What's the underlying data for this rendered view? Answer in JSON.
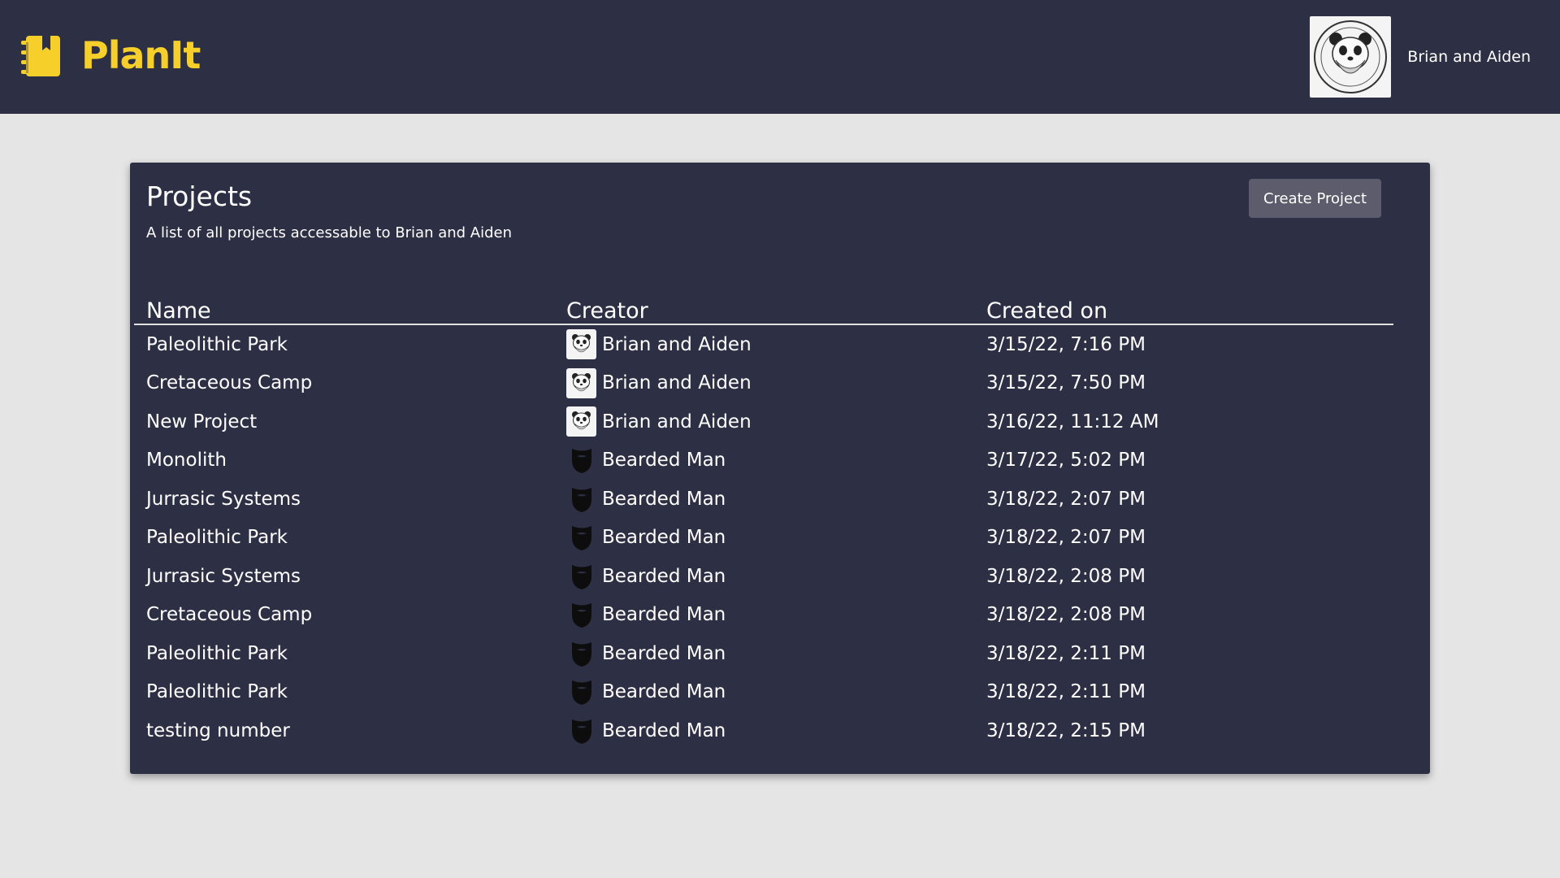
{
  "app": {
    "name": "PlanIt"
  },
  "brand": {
    "accent": "#f7cf2a",
    "surface": "#2d3044",
    "background": "#e5e5e5",
    "button": "#5d5c6c"
  },
  "user": {
    "name": "Brian and Aiden",
    "avatar_icon": "bearded-panda-logo-icon"
  },
  "projects_card": {
    "title": "Projects",
    "subtitle": "A list of all projects accessable to Brian and Aiden",
    "create_button_label": "Create Project",
    "columns": {
      "name": "Name",
      "creator": "Creator",
      "created_on": "Created on"
    },
    "rows": [
      {
        "name": "Paleolithic Park",
        "creator": "Brian and Aiden",
        "creator_icon": "panda-avatar-icon",
        "created_on": "3/15/22, 7:16 PM"
      },
      {
        "name": "Cretaceous Camp",
        "creator": "Brian and Aiden",
        "creator_icon": "panda-avatar-icon",
        "created_on": "3/15/22, 7:50 PM"
      },
      {
        "name": "New Project",
        "creator": "Brian and Aiden",
        "creator_icon": "panda-avatar-icon",
        "created_on": "3/16/22, 11:12 AM"
      },
      {
        "name": "Monolith",
        "creator": "Bearded Man",
        "creator_icon": "beard-avatar-icon",
        "created_on": "3/17/22, 5:02 PM"
      },
      {
        "name": "Jurrasic Systems",
        "creator": "Bearded Man",
        "creator_icon": "beard-avatar-icon",
        "created_on": "3/18/22, 2:07 PM"
      },
      {
        "name": "Paleolithic Park",
        "creator": "Bearded Man",
        "creator_icon": "beard-avatar-icon",
        "created_on": "3/18/22, 2:07 PM"
      },
      {
        "name": "Jurrasic Systems",
        "creator": "Bearded Man",
        "creator_icon": "beard-avatar-icon",
        "created_on": "3/18/22, 2:08 PM"
      },
      {
        "name": "Cretaceous Camp",
        "creator": "Bearded Man",
        "creator_icon": "beard-avatar-icon",
        "created_on": "3/18/22, 2:08 PM"
      },
      {
        "name": "Paleolithic Park",
        "creator": "Bearded Man",
        "creator_icon": "beard-avatar-icon",
        "created_on": "3/18/22, 2:11 PM"
      },
      {
        "name": "Paleolithic Park",
        "creator": "Bearded Man",
        "creator_icon": "beard-avatar-icon",
        "created_on": "3/18/22, 2:11 PM"
      },
      {
        "name": "testing number",
        "creator": "Bearded Man",
        "creator_icon": "beard-avatar-icon",
        "created_on": "3/18/22, 2:15 PM"
      }
    ]
  }
}
